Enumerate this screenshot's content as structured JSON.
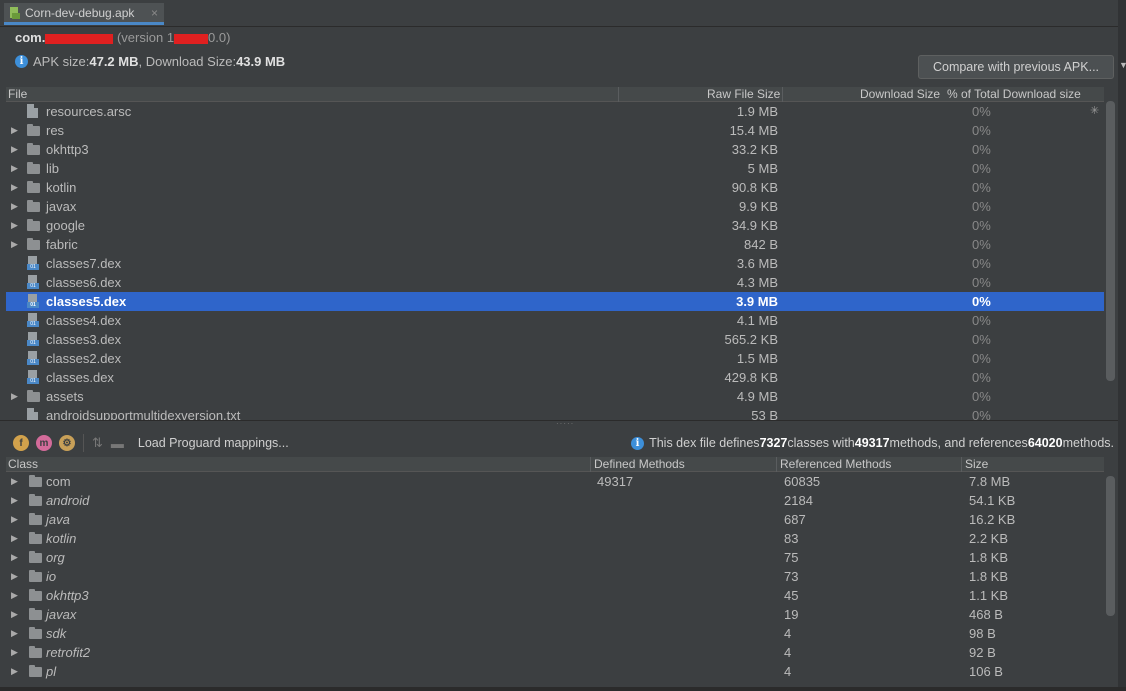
{
  "tab": {
    "title": "Corn-dev-debug.apk",
    "close": "×"
  },
  "package": {
    "name_prefix": "com.",
    "version_prefix": "(version 1",
    "version_suffix": "0.0)"
  },
  "size_summary": {
    "apk_label": "APK size: ",
    "apk_value": "47.2 MB",
    "download_label": ", Download Size: ",
    "download_value": "43.9 MB"
  },
  "compare_button": "Compare with previous APK...",
  "file_table": {
    "columns": {
      "file": "File",
      "raw_size": "Raw File Size",
      "download_size": "Download Size",
      "pct": "% of Total Download size"
    },
    "rows": [
      {
        "name": "resources.arsc",
        "raw": "1.9 MB",
        "pct": "0%",
        "icon": "file-icon",
        "expandable": false
      },
      {
        "name": "res",
        "raw": "15.4 MB",
        "pct": "0%",
        "icon": "folder-icon",
        "expandable": true
      },
      {
        "name": "okhttp3",
        "raw": "33.2 KB",
        "pct": "0%",
        "icon": "folder-icon",
        "expandable": true
      },
      {
        "name": "lib",
        "raw": "5 MB",
        "pct": "0%",
        "icon": "folder-icon",
        "expandable": true
      },
      {
        "name": "kotlin",
        "raw": "90.8 KB",
        "pct": "0%",
        "icon": "folder-icon",
        "expandable": true
      },
      {
        "name": "javax",
        "raw": "9.9 KB",
        "pct": "0%",
        "icon": "folder-icon",
        "expandable": true
      },
      {
        "name": "google",
        "raw": "34.9 KB",
        "pct": "0%",
        "icon": "folder-icon",
        "expandable": true
      },
      {
        "name": "fabric",
        "raw": "842 B",
        "pct": "0%",
        "icon": "folder-icon",
        "expandable": true
      },
      {
        "name": "classes7.dex",
        "raw": "3.6 MB",
        "pct": "0%",
        "icon": "dex-icon",
        "expandable": false
      },
      {
        "name": "classes6.dex",
        "raw": "4.3 MB",
        "pct": "0%",
        "icon": "dex-icon",
        "expandable": false
      },
      {
        "name": "classes5.dex",
        "raw": "3.9 MB",
        "pct": "0%",
        "icon": "dex-icon",
        "expandable": false,
        "selected": true
      },
      {
        "name": "classes4.dex",
        "raw": "4.1 MB",
        "pct": "0%",
        "icon": "dex-icon",
        "expandable": false
      },
      {
        "name": "classes3.dex",
        "raw": "565.2 KB",
        "pct": "0%",
        "icon": "dex-icon",
        "expandable": false
      },
      {
        "name": "classes2.dex",
        "raw": "1.5 MB",
        "pct": "0%",
        "icon": "dex-icon",
        "expandable": false
      },
      {
        "name": "classes.dex",
        "raw": "429.8 KB",
        "pct": "0%",
        "icon": "dex-icon",
        "expandable": false
      },
      {
        "name": "assets",
        "raw": "4.9 MB",
        "pct": "0%",
        "icon": "folder-icon",
        "expandable": true
      },
      {
        "name": "androidsupportmultidexversion.txt",
        "raw": "53 B",
        "pct": "0%",
        "icon": "file-icon",
        "expandable": false
      }
    ]
  },
  "dex_toolbar": {
    "field_filter": "f",
    "method_filter": "m",
    "proguard_label": "Load Proguard mappings...",
    "info_prefix": "This dex file defines ",
    "classes_count": "7327",
    "info_mid1": " classes with ",
    "methods_count": "49317",
    "info_mid2": " methods, and references ",
    "ref_count": "64020",
    "info_suffix": " methods."
  },
  "class_table": {
    "columns": {
      "class": "Class",
      "defined": "Defined Methods",
      "referenced": "Referenced Methods",
      "size": "Size"
    },
    "rows": [
      {
        "name": "com",
        "defined": "49317",
        "referenced": "60835",
        "size": "7.8 MB",
        "italic": false
      },
      {
        "name": "android",
        "defined": "",
        "referenced": "2184",
        "size": "54.1 KB",
        "italic": true
      },
      {
        "name": "java",
        "defined": "",
        "referenced": "687",
        "size": "16.2 KB",
        "italic": true
      },
      {
        "name": "kotlin",
        "defined": "",
        "referenced": "83",
        "size": "2.2 KB",
        "italic": true
      },
      {
        "name": "org",
        "defined": "",
        "referenced": "75",
        "size": "1.8 KB",
        "italic": true
      },
      {
        "name": "io",
        "defined": "",
        "referenced": "73",
        "size": "1.8 KB",
        "italic": true
      },
      {
        "name": "okhttp3",
        "defined": "",
        "referenced": "45",
        "size": "1.1 KB",
        "italic": true
      },
      {
        "name": "javax",
        "defined": "",
        "referenced": "19",
        "size": "468 B",
        "italic": true
      },
      {
        "name": "sdk",
        "defined": "",
        "referenced": "4",
        "size": "98 B",
        "italic": true
      },
      {
        "name": "retrofit2",
        "defined": "",
        "referenced": "4",
        "size": "92 B",
        "italic": true
      },
      {
        "name": "pl",
        "defined": "",
        "referenced": "4",
        "size": "106 B",
        "italic": true
      }
    ]
  }
}
